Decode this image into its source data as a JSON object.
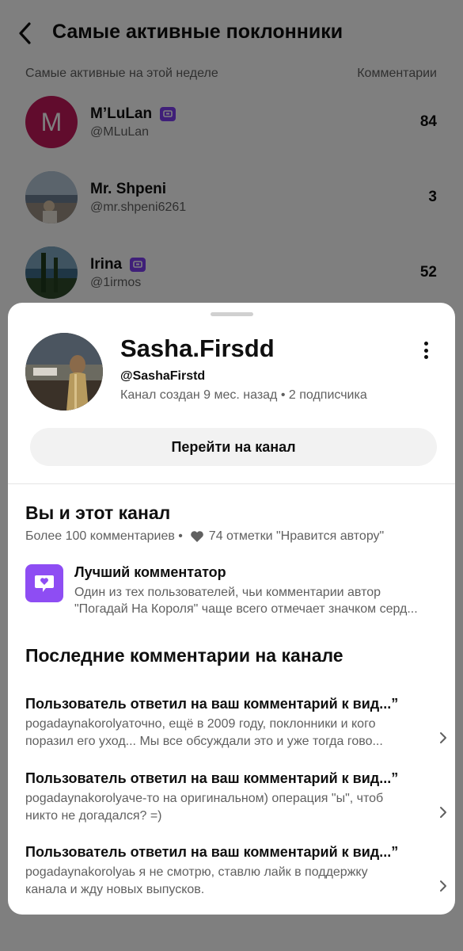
{
  "page": {
    "title": "Самые активные поклонники",
    "list_header_left": "Самые активные на этой неделе",
    "list_header_right": "Комментарии"
  },
  "fans": [
    {
      "initial": "M",
      "name": "M’LuLan",
      "handle": "@MLuLan",
      "count": "84",
      "member": true
    },
    {
      "initial": "",
      "name": "Mr. Shpeni",
      "handle": "@mr.shpeni6261",
      "count": "3",
      "member": false
    },
    {
      "initial": "",
      "name": "Irina",
      "handle": "@1irmos",
      "count": "52",
      "member": true
    }
  ],
  "sheet": {
    "channel_name": "Sasha.Firsdd",
    "channel_handle": "@SashaFirstd",
    "created": "Канал создан 9 мес. назад",
    "subscribers": "2 подписчика",
    "goto_button": "Перейти на канал",
    "you_and_channel_title": "Вы и этот канал",
    "comments_stat": "Более 100 комментариев",
    "likes_stat": "74 отметки \"Нравится автору\"",
    "top_commenter_title": "Лучший комментатор",
    "top_commenter_desc_1": "Один из тех пользователей, чьи комментарии автор",
    "top_commenter_desc_2": "\"Погадай На Короля\" чаще всего отмечает значком серд...",
    "recent_title": "Последние комментарии на канале",
    "comments": [
      {
        "title": "Пользователь ответил на ваш комментарий к вид...”",
        "line1": "pogadaynakorolyaточно,  ещё в 2009 году, поклонники и кого",
        "line2": "поразил его уход... Мы все обсуждали это и уже тогда гово..."
      },
      {
        "title": "Пользователь ответил на ваш комментарий к вид...”",
        "line1": "pogadaynakorolyaче-то на оригинальном) операция \"ы\", чтоб",
        "line2": "никто не догадался? =)"
      },
      {
        "title": "Пользователь ответил на ваш комментарий к вид...”",
        "line1": "pogadaynakorolyaь я не смотрю, ставлю лайк в поддержку",
        "line2": "канала и жду новых выпусков."
      }
    ]
  },
  "colors": {
    "accent_purple": "#8e4df3",
    "letter_avatar": "#c2185b",
    "secondary_text": "#606060",
    "button_bg": "#f2f2f2"
  },
  "icons": [
    "back-arrow-icon",
    "member-badge-icon",
    "kebab-menu-icon",
    "heart-icon",
    "top-commenter-heart-icon",
    "chevron-right-icon"
  ]
}
